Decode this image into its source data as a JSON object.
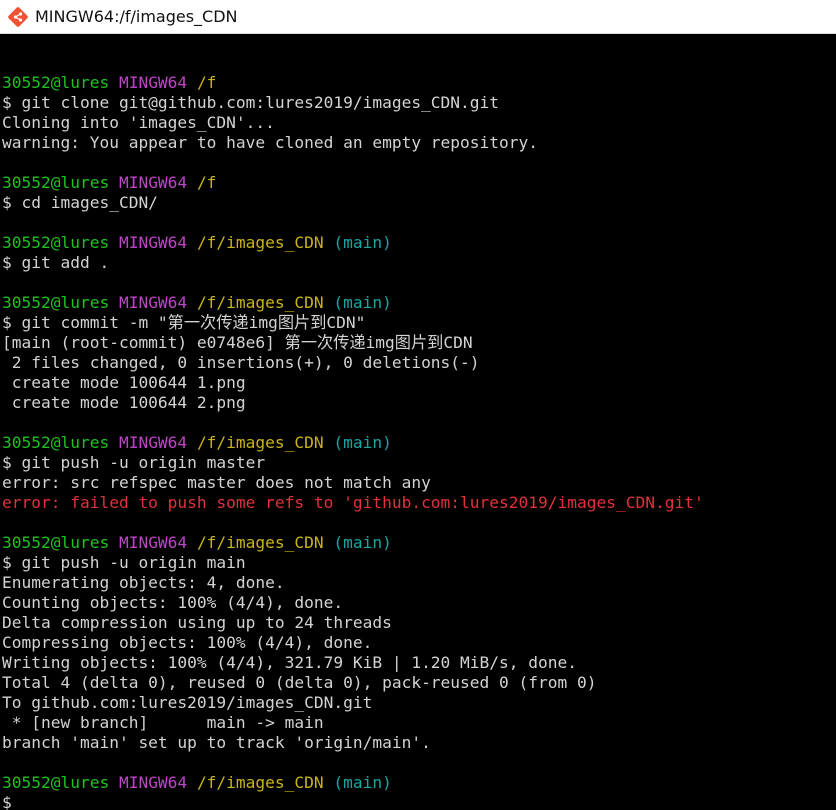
{
  "window": {
    "title": "MINGW64:/f/images_CDN",
    "icon": "git-bash-icon"
  },
  "colors": {
    "user": "#1fc21f",
    "host": "#bf44c9",
    "path": "#c9b418",
    "branch": "#17a6a6",
    "error": "#e0323a",
    "text": "#d3d3d3",
    "background": "#000000"
  },
  "terminal": {
    "lines": [
      {
        "type": "blank"
      },
      {
        "type": "prompt",
        "user": "30552@lures",
        "host": "MINGW64",
        "path": "/f",
        "branch": ""
      },
      {
        "type": "text",
        "text": "$ git clone git@github.com:lures2019/images_CDN.git"
      },
      {
        "type": "text",
        "text": "Cloning into 'images_CDN'..."
      },
      {
        "type": "text",
        "text": "warning: You appear to have cloned an empty repository."
      },
      {
        "type": "blank"
      },
      {
        "type": "prompt",
        "user": "30552@lures",
        "host": "MINGW64",
        "path": "/f",
        "branch": ""
      },
      {
        "type": "text",
        "text": "$ cd images_CDN/"
      },
      {
        "type": "blank"
      },
      {
        "type": "prompt",
        "user": "30552@lures",
        "host": "MINGW64",
        "path": "/f/images_CDN",
        "branch": "(main)"
      },
      {
        "type": "text",
        "text": "$ git add ."
      },
      {
        "type": "blank"
      },
      {
        "type": "prompt",
        "user": "30552@lures",
        "host": "MINGW64",
        "path": "/f/images_CDN",
        "branch": "(main)"
      },
      {
        "type": "text",
        "text": "$ git commit -m \"第一次传递img图片到CDN\""
      },
      {
        "type": "text",
        "text": "[main (root-commit) e0748e6] 第一次传递img图片到CDN"
      },
      {
        "type": "text",
        "text": " 2 files changed, 0 insertions(+), 0 deletions(-)"
      },
      {
        "type": "text",
        "text": " create mode 100644 1.png"
      },
      {
        "type": "text",
        "text": " create mode 100644 2.png"
      },
      {
        "type": "blank"
      },
      {
        "type": "prompt",
        "user": "30552@lures",
        "host": "MINGW64",
        "path": "/f/images_CDN",
        "branch": "(main)"
      },
      {
        "type": "text",
        "text": "$ git push -u origin master"
      },
      {
        "type": "text",
        "text": "error: src refspec master does not match any"
      },
      {
        "type": "error",
        "text": "error: failed to push some refs to 'github.com:lures2019/images_CDN.git'"
      },
      {
        "type": "blank"
      },
      {
        "type": "prompt",
        "user": "30552@lures",
        "host": "MINGW64",
        "path": "/f/images_CDN",
        "branch": "(main)"
      },
      {
        "type": "text",
        "text": "$ git push -u origin main"
      },
      {
        "type": "text",
        "text": "Enumerating objects: 4, done."
      },
      {
        "type": "text",
        "text": "Counting objects: 100% (4/4), done."
      },
      {
        "type": "text",
        "text": "Delta compression using up to 24 threads"
      },
      {
        "type": "text",
        "text": "Compressing objects: 100% (4/4), done."
      },
      {
        "type": "text",
        "text": "Writing objects: 100% (4/4), 321.79 KiB | 1.20 MiB/s, done."
      },
      {
        "type": "text",
        "text": "Total 4 (delta 0), reused 0 (delta 0), pack-reused 0 (from 0)"
      },
      {
        "type": "text",
        "text": "To github.com:lures2019/images_CDN.git"
      },
      {
        "type": "text",
        "text": " * [new branch]      main -> main"
      },
      {
        "type": "text",
        "text": "branch 'main' set up to track 'origin/main'."
      },
      {
        "type": "blank"
      },
      {
        "type": "prompt",
        "user": "30552@lures",
        "host": "MINGW64",
        "path": "/f/images_CDN",
        "branch": "(main)"
      },
      {
        "type": "input",
        "text": "$ "
      }
    ]
  }
}
